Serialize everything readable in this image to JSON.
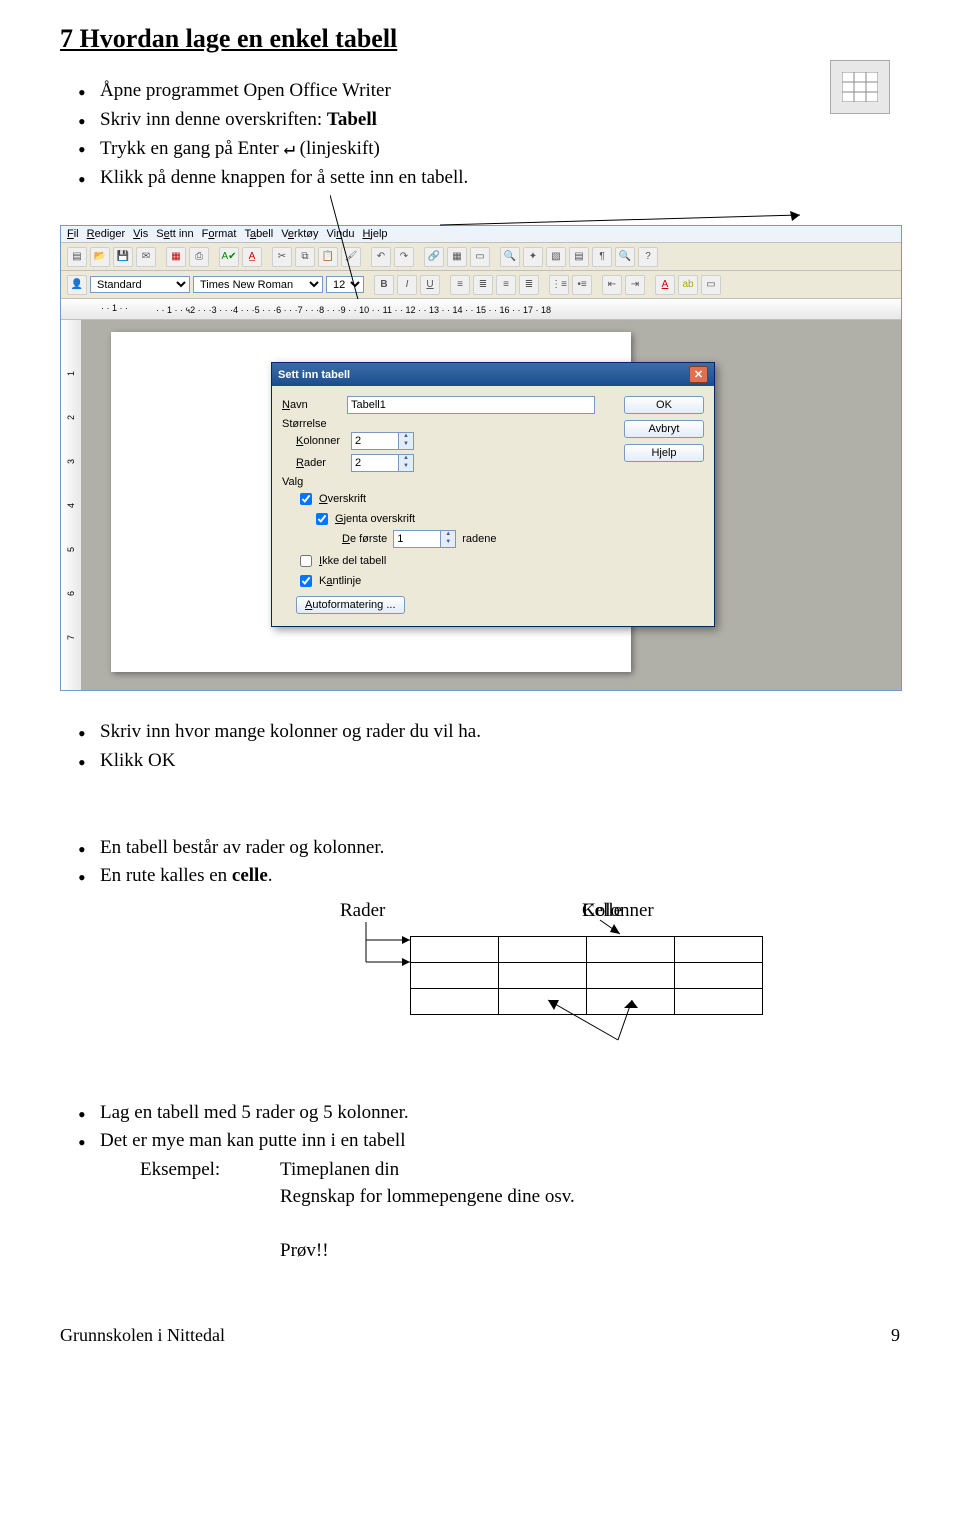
{
  "title": "7  Hvordan lage en enkel tabell",
  "intro": {
    "i1": "Åpne programmet Open Office Writer",
    "i2a": "Skriv inn denne overskriften: ",
    "i2b": "Tabell",
    "i3a": "Trykk en gang på Enter ",
    "i3b": "↵",
    "i3c": " (linjeskift)",
    "i4": "Klikk på denne knappen for å sette inn en tabell."
  },
  "oo": {
    "menus": [
      "Fil",
      "Rediger",
      "Vis",
      "Sett inn",
      "Format",
      "Tabell",
      "Verktøy",
      "Vindu",
      "Hjelp"
    ],
    "style": "Standard",
    "font": "Times New Roman",
    "size": "12",
    "ruler_nums": [
      "1",
      "1",
      "2",
      "3",
      "4",
      "5",
      "6",
      "7",
      "8",
      "9",
      "10",
      "11",
      "12",
      "13",
      "14",
      "15",
      "16",
      "17",
      "18"
    ],
    "vruler_nums": [
      "1",
      "2",
      "3",
      "4",
      "5",
      "6",
      "7"
    ]
  },
  "dlg": {
    "title": "Sett inn tabell",
    "navn_label": "Navn",
    "navn_value": "Tabell1",
    "storrelse": "Størrelse",
    "kolonner_label": "Kolonner",
    "kolonner_value": "2",
    "rader_label": "Rader",
    "rader_value": "2",
    "valg": "Valg",
    "chk_overskrift": "Overskrift",
    "chk_gjenta": "Gjenta overskrift",
    "deforste_label": "De første",
    "deforste_value": "1",
    "deforste_suffix": "radene",
    "chk_ikkedel": "Ikke del tabell",
    "chk_kantlinje": "Kantlinje",
    "autoformat": "Autoformatering ...",
    "btn_ok": "OK",
    "btn_avbryt": "Avbryt",
    "btn_hjelp": "Hjelp"
  },
  "mid": {
    "m1": "Skriv inn hvor mange kolonner og rader du vil ha.",
    "m2": "Klikk OK",
    "m3": "En tabell består av rader og kolonner.",
    "m4a": "En rute kalles en ",
    "m4b": "celle",
    "m4c": "."
  },
  "diagram": {
    "rader": "Rader",
    "celle": "Celle",
    "kolonner": "Kolonner"
  },
  "outro": {
    "o1": "Lag en tabell med 5 rader og 5 kolonner.",
    "o2": "Det er mye man kan putte inn i en tabell",
    "ex_label": "Eksempel:",
    "ex1": "Timeplanen din",
    "ex2": "Regnskap for lommepengene dine  osv.",
    "prov": "Prøv!!"
  },
  "footer": {
    "left": "Grunnskolen i Nittedal",
    "right": "9"
  }
}
